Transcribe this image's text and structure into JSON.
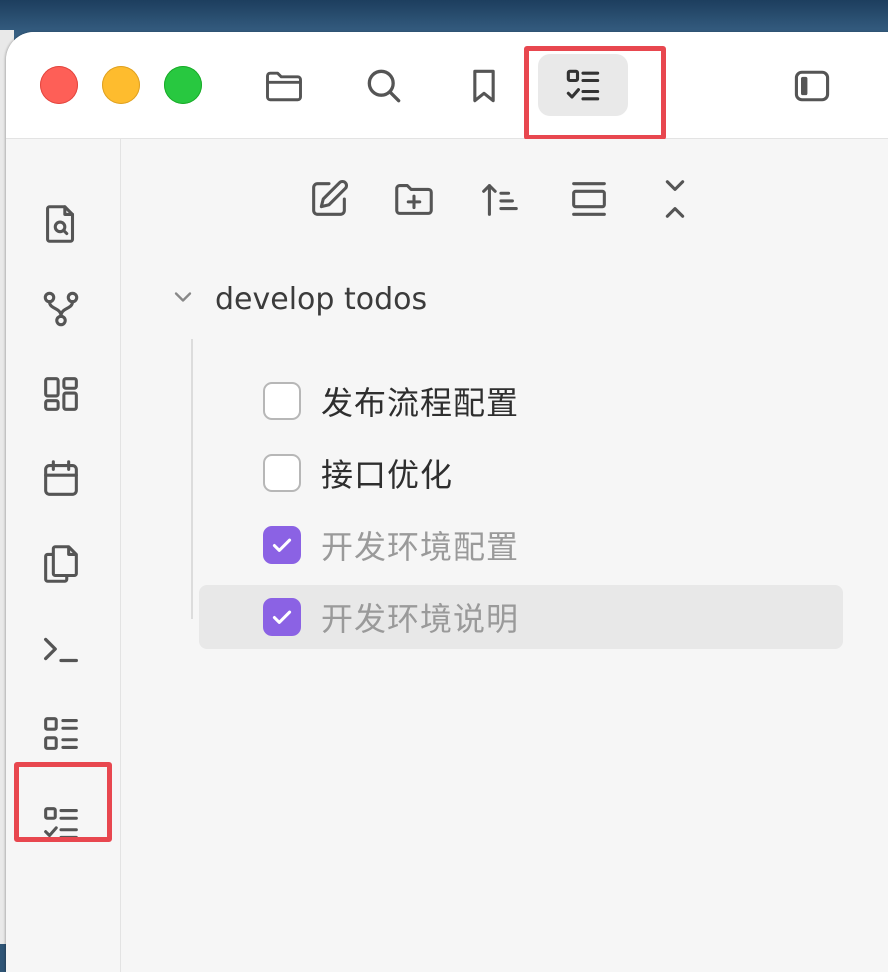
{
  "colors": {
    "accent": "#8b62e4",
    "highlight_box": "#e8474f",
    "traffic_red": "#fe5f57",
    "traffic_yellow": "#febc2e",
    "traffic_green": "#28c840"
  },
  "titlebar": {
    "icons": [
      "folder-icon",
      "search-icon",
      "bookmark-icon",
      "tasks-view-icon",
      "sidebar-toggle-icon"
    ],
    "active": "tasks-view-icon"
  },
  "ribbon": {
    "icons": [
      "file-search-icon",
      "graph-icon",
      "dashboard-grid-icon",
      "calendar-icon",
      "copy-files-icon",
      "terminal-icon",
      "checklist-icon",
      "tasks-icon"
    ],
    "highlighted": "tasks-icon"
  },
  "panel_nav": {
    "icons": [
      "new-note-icon",
      "new-folder-icon",
      "sort-icon",
      "collapse-view-icon",
      "expand-collapse-icon"
    ]
  },
  "task_group": {
    "title": "develop todos",
    "expanded": true,
    "tasks": [
      {
        "label": "发布流程配置",
        "done": false
      },
      {
        "label": "接口优化",
        "done": false
      },
      {
        "label": "开发环境配置",
        "done": true
      },
      {
        "label": "开发环境说明",
        "done": true
      }
    ]
  }
}
